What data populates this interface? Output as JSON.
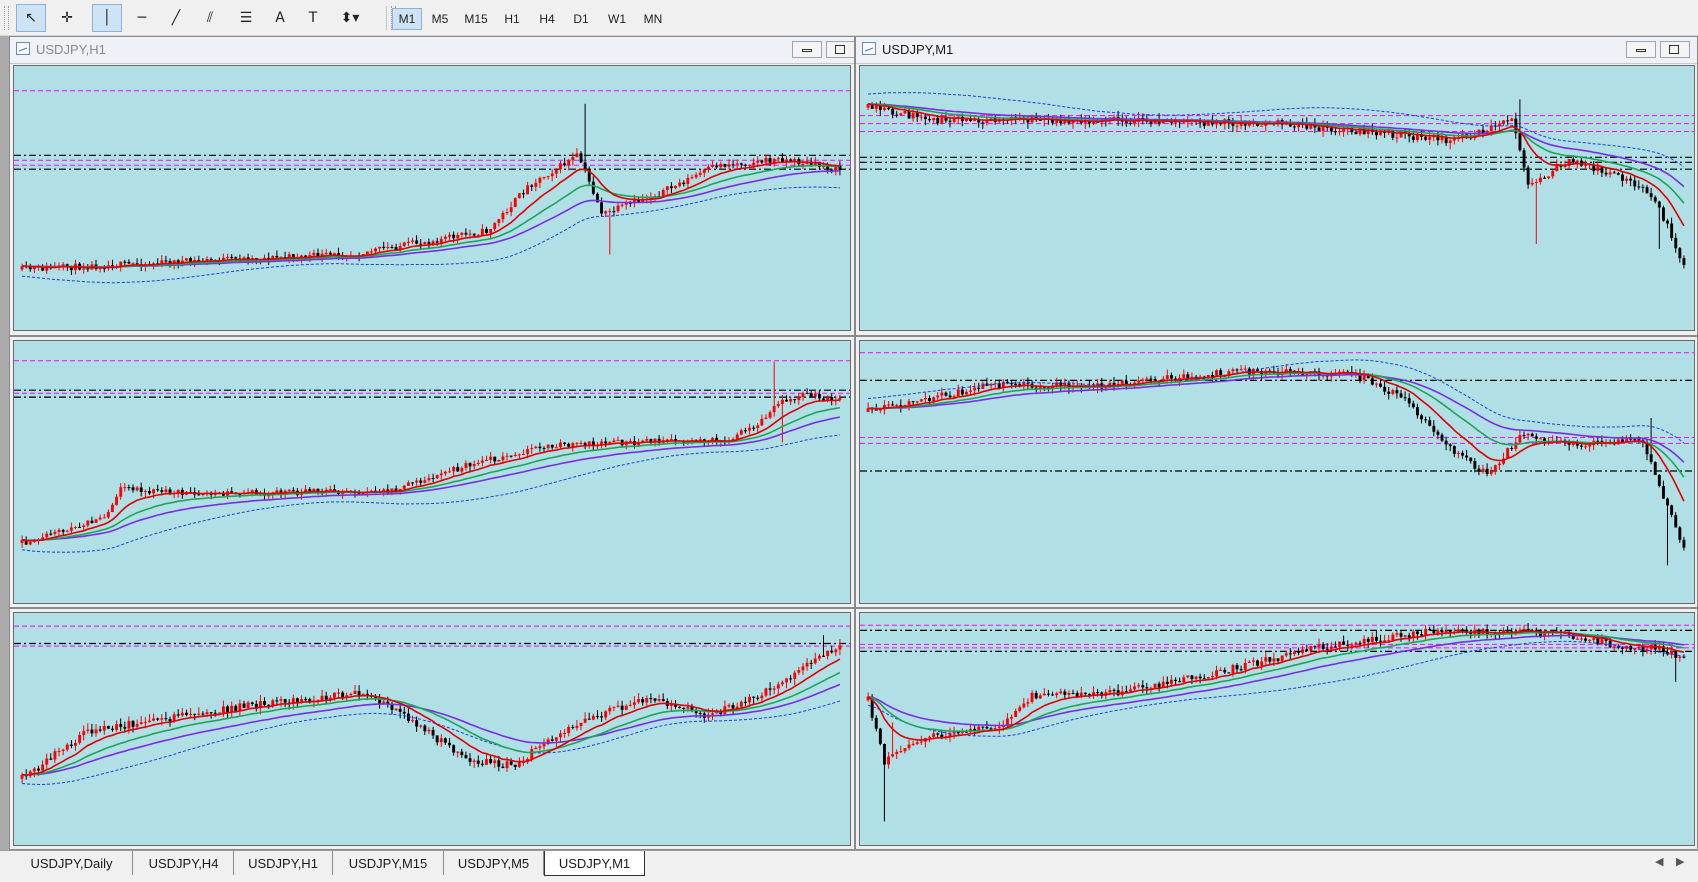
{
  "toolbar": {
    "tools": [
      {
        "icon": "cursor-arrow-icon",
        "glyph": "↖",
        "active": true
      },
      {
        "icon": "crosshair-icon",
        "glyph": "✛",
        "active": false
      },
      {
        "icon": "vertical-line-icon",
        "glyph": "│",
        "active": true
      },
      {
        "icon": "horizontal-line-icon",
        "glyph": "─",
        "active": false
      },
      {
        "icon": "trendline-icon",
        "glyph": "╱",
        "active": false
      },
      {
        "icon": "equidistant-channel-icon",
        "glyph": "⫽",
        "active": false
      },
      {
        "icon": "fibonacci-retracement-icon",
        "glyph": "☰",
        "active": false
      },
      {
        "icon": "text-icon",
        "glyph": "A",
        "active": false
      },
      {
        "icon": "text-label-icon",
        "glyph": "T",
        "active": false
      },
      {
        "icon": "arrows-menu-icon",
        "glyph": "⬍▾",
        "active": false
      }
    ],
    "timeframes": [
      "M1",
      "M5",
      "M15",
      "H1",
      "H4",
      "D1",
      "W1",
      "MN"
    ],
    "active_timeframe": "M1"
  },
  "windows": [
    {
      "title": "USDJPY,H1",
      "active": false
    },
    {
      "title": "USDJPY,M1",
      "active": true
    }
  ],
  "tabs": [
    "USDJPY,Daily",
    "USDJPY,H4",
    "USDJPY,H1",
    "USDJPY,M15",
    "USDJPY,M5",
    "USDJPY,M1"
  ],
  "active_tab": "USDJPY,M1",
  "colors": {
    "chart_bg": "#b0dfe5",
    "bull_candle": "#ff0000",
    "bear_candle": "#000000",
    "ma_fast": "#e00000",
    "ma_mid": "#1fa55a",
    "ma_slow": "#7a2ee0",
    "envelope": "#1b3be6",
    "level_magenta": "#ff00ff",
    "level_black": "#000000"
  }
}
